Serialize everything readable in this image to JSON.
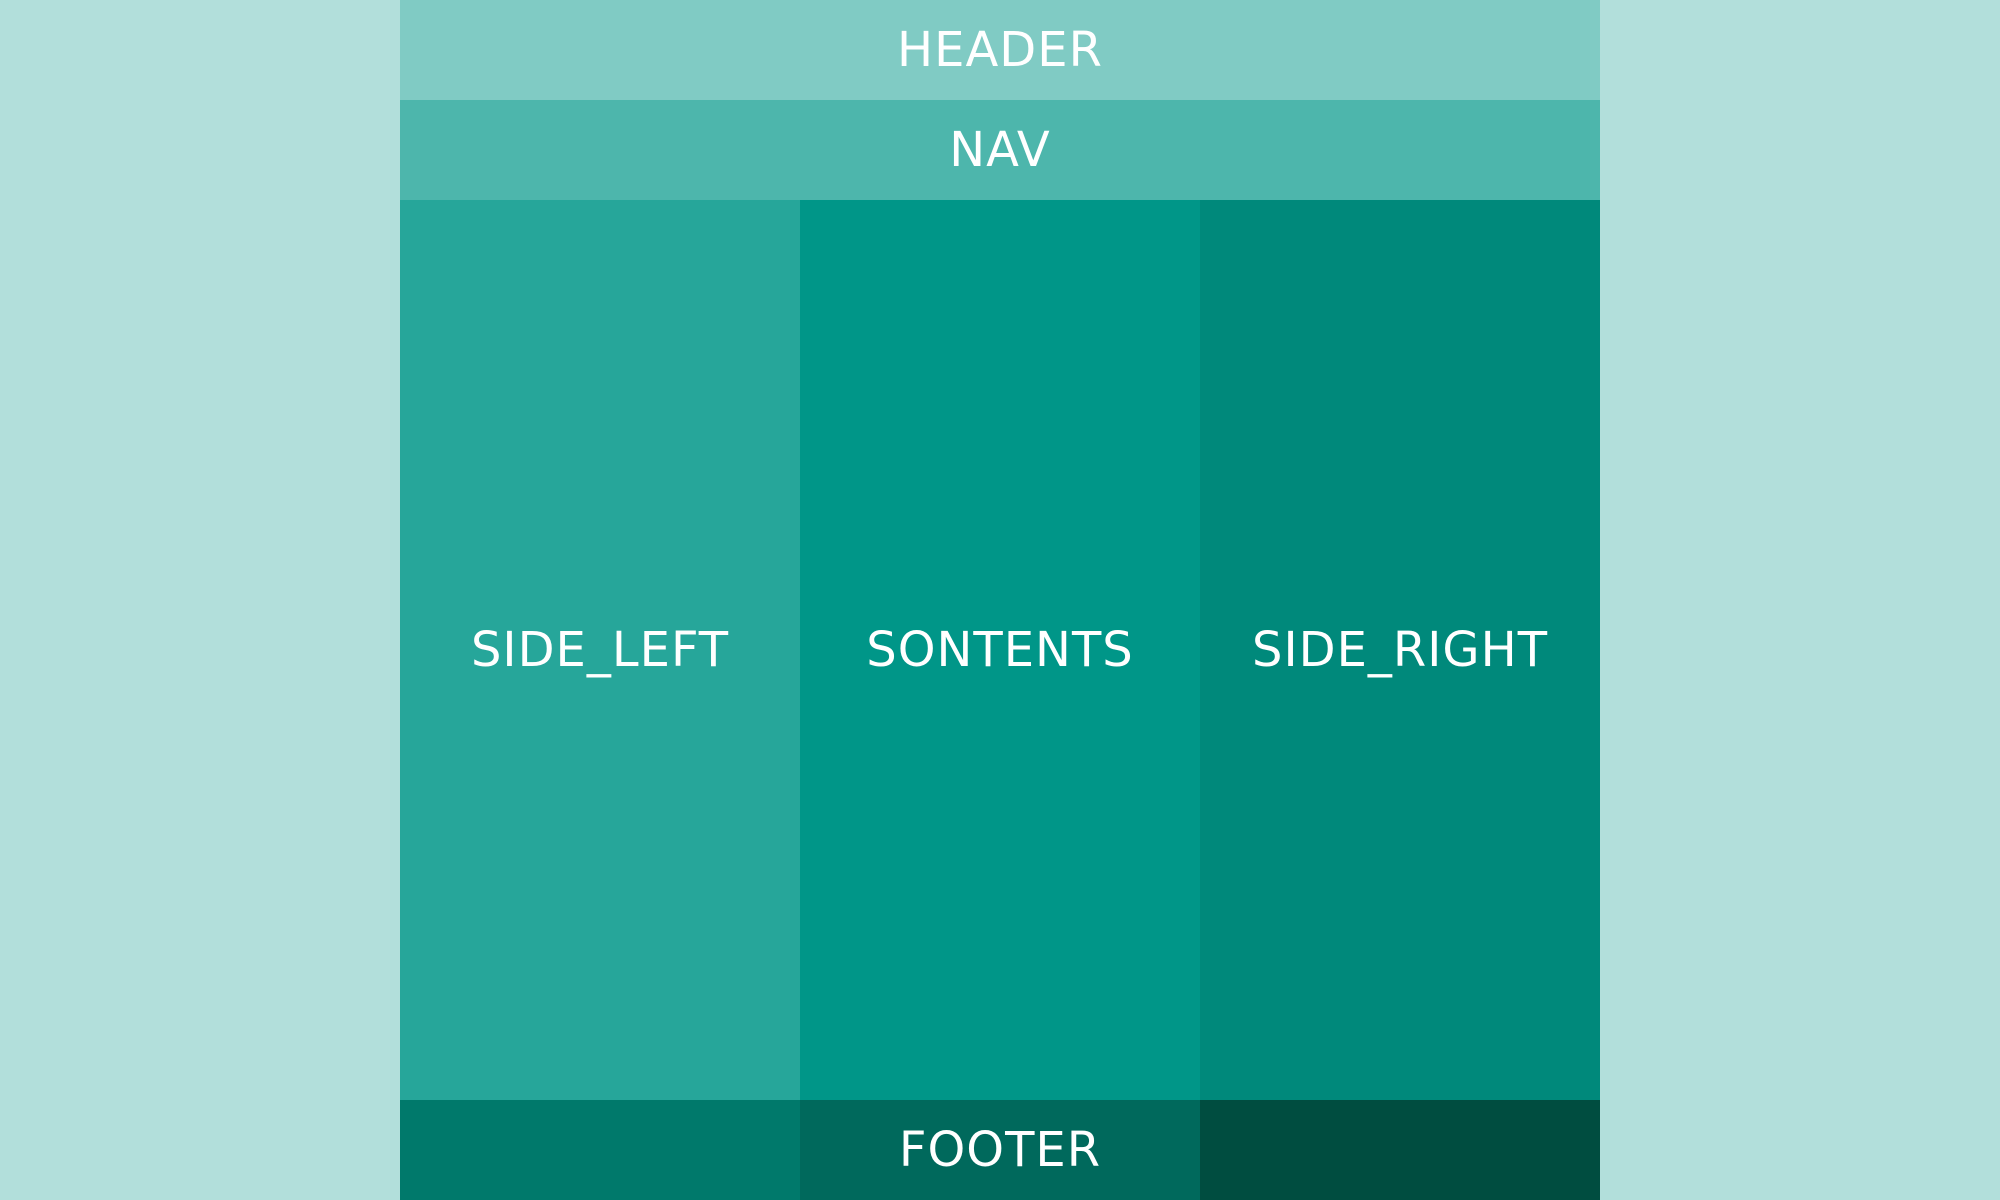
{
  "header": {
    "label": "HEADER"
  },
  "nav": {
    "label": "NAV"
  },
  "columns": {
    "side_left": "SIDE_LEFT",
    "contents": "SONTENTS",
    "side_right": "SIDE_RIGHT"
  },
  "footer": {
    "label": "FOOTER"
  },
  "colors": {
    "background": "#b2dfdb",
    "header": "#80cbc4",
    "nav": "#4db6ac",
    "side_left": "#26a69a",
    "contents": "#009688",
    "side_right": "#00897b",
    "footer_left": "#00796b",
    "footer_center": "#00695c",
    "footer_right": "#004d40",
    "text": "#ffffff"
  }
}
